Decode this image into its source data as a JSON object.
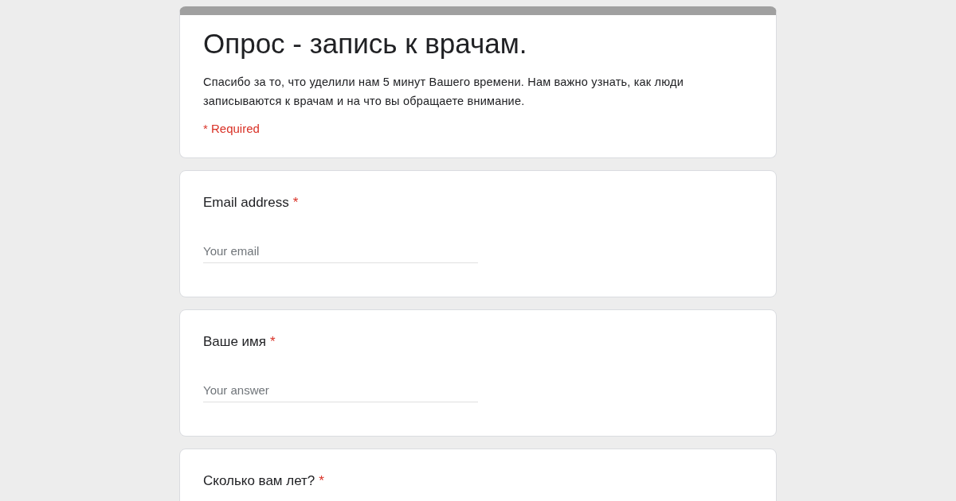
{
  "form": {
    "title": "Опрос - запись к врачам.",
    "description": "Спасибо за то, что уделили нам 5 минут Вашего времени. Нам важно узнать, как люди записываются к врачам и на что вы обращаете внимание.",
    "required_note": "* Required"
  },
  "questions": [
    {
      "label": "Email address",
      "required_mark": "*",
      "placeholder": "Your email"
    },
    {
      "label": "Ваше имя",
      "required_mark": "*",
      "placeholder": "Your answer"
    },
    {
      "label": "Сколько вам лет?",
      "required_mark": "*"
    }
  ]
}
